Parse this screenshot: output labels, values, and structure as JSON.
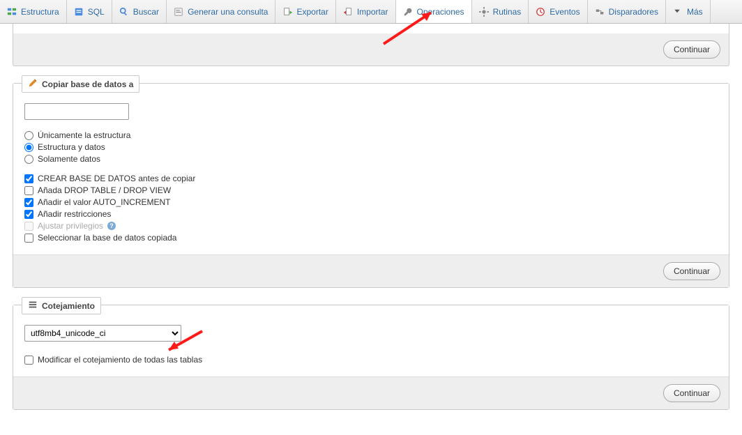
{
  "tabs": {
    "estructura": "Estructura",
    "sql": "SQL",
    "buscar": "Buscar",
    "generar": "Generar una consulta",
    "exportar": "Exportar",
    "importar": "Importar",
    "operaciones": "Operaciones",
    "rutinas": "Rutinas",
    "eventos": "Eventos",
    "disparadores": "Disparadores",
    "mas": "Más"
  },
  "topPanel": {
    "continue": "Continuar"
  },
  "copy": {
    "legend": "Copiar base de datos a",
    "target_value": "",
    "radio_structure_only": "Únicamente la estructura",
    "radio_structure_data": "Estructura y datos",
    "radio_data_only": "Solamente datos",
    "chk_create_db": "CREAR BASE DE DATOS antes de copiar",
    "chk_drop": "Añada DROP TABLE / DROP VIEW",
    "chk_autoinc": "Añadir el valor AUTO_INCREMENT",
    "chk_constraints": "Añadir restricciones",
    "chk_privs": "Ajustar privilegios",
    "chk_select_copied": "Seleccionar la base de datos copiada",
    "continue": "Continuar"
  },
  "collation": {
    "legend": "Cotejamiento",
    "selected": "utf8mb4_unicode_ci",
    "chk_all_tables": "Modificar el cotejamiento de todas las tablas",
    "continue": "Continuar"
  }
}
